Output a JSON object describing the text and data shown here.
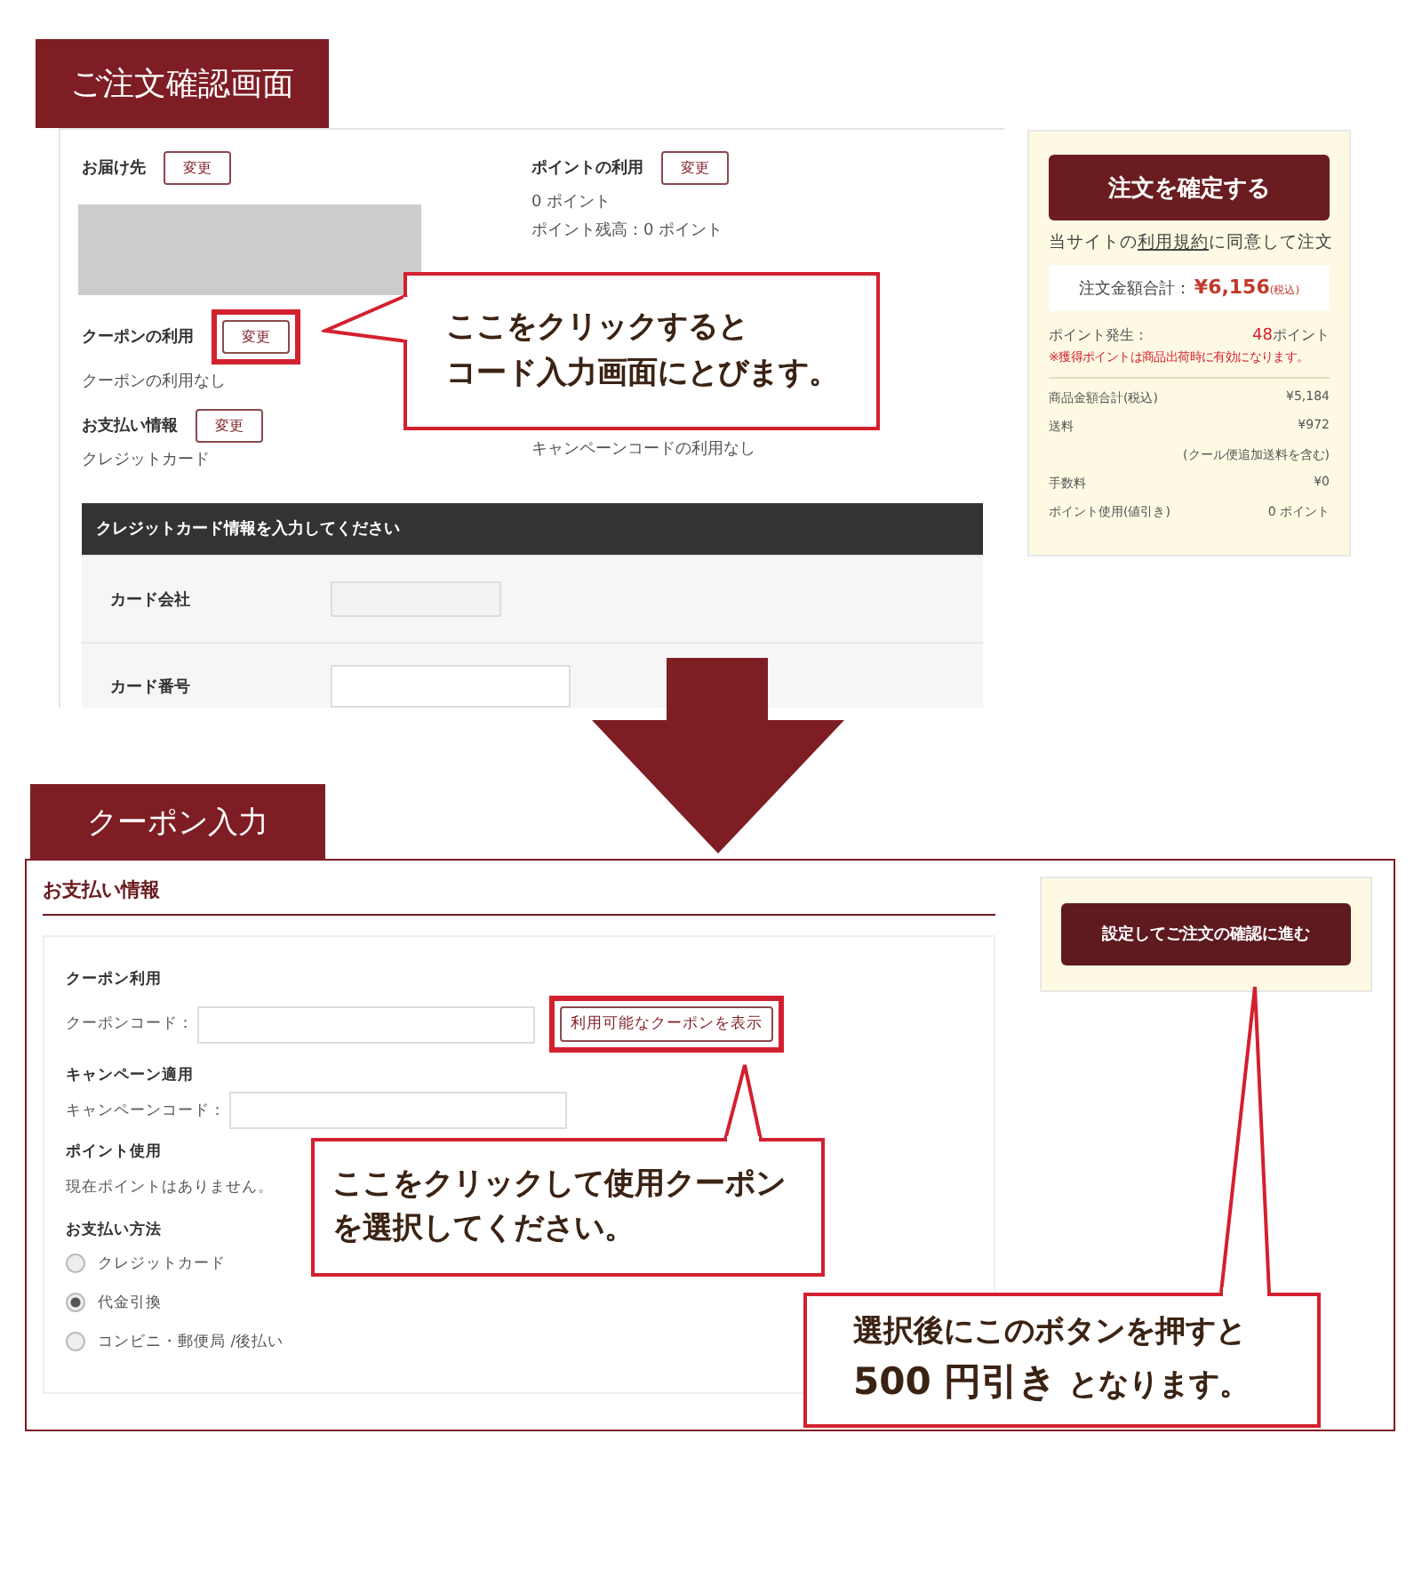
{
  "order_screen": {
    "title": "ご注文確認画面",
    "delivery": {
      "label": "お届け先",
      "button": "変更"
    },
    "points": {
      "label": "ポイントの利用",
      "button": "変更",
      "lines": [
        "0 ポイント",
        "ポイント残高：0 ポイント"
      ]
    },
    "coupon": {
      "label": "クーポンの利用",
      "button": "変更",
      "value": "クーポンの利用なし",
      "highlighted": true
    },
    "payment": {
      "label": "お支払い情報",
      "button": "変更",
      "value": "クレジットカード"
    },
    "campaign_value": "キャンペーンコードの利用なし",
    "card_form": {
      "heading": "クレジットカード情報を入力してください",
      "fields": [
        {
          "label": "カード会社"
        },
        {
          "label": "カード番号"
        }
      ]
    },
    "summary": {
      "confirm_button": "注文を確定する",
      "terms_before": "当サイトの",
      "terms_link": "利用規約",
      "terms_after": "に同意して注文",
      "total_label": "注文金額合計：",
      "total_value": "¥6,156",
      "total_tax": "(税込)",
      "points_label": "ポイント発生：",
      "points_value": "48",
      "points_unit": "ポイント",
      "points_note": "※獲得ポイントは商品出荷時に有効になります。",
      "rows": [
        {
          "label": "商品金額合計(税込)",
          "value": "¥5,184"
        },
        {
          "label": "送料",
          "value": "¥972"
        },
        {
          "label": "",
          "value": "(クール便追加送料を含む)"
        },
        {
          "label": "手数料",
          "value": "¥0"
        },
        {
          "label": "ポイント使用(値引き)",
          "value": "0 ポイント"
        }
      ]
    },
    "callout": [
      "ここをクリックすると",
      "コード入力画面にとびます。"
    ]
  },
  "coupon_screen": {
    "title": "クーポン入力",
    "heading": "お支払い情報",
    "coupon_group": "クーポン利用",
    "coupon_label": "クーポンコード：",
    "coupon_button": "利用可能なクーポンを表示",
    "coupon_button_highlighted": true,
    "campaign_group": "キャンペーン適用",
    "campaign_label": "キャンペーンコード：",
    "points_group": "ポイント使用",
    "points_text": "現在ポイントはありません。",
    "method_group": "お支払い方法",
    "methods": [
      {
        "label": "クレジットカード",
        "selected": false
      },
      {
        "label": "代金引換",
        "selected": true
      },
      {
        "label": "コンビニ・郵便局 /後払い",
        "selected": false
      }
    ],
    "proceed_button": "設定してご注文の確認に進む",
    "callout": [
      "ここをクリックして使用クーポン",
      "を選択してください。"
    ],
    "callout2": {
      "line1": "選択後にこのボタンを押すと",
      "emphasis": "500 円引き",
      "rest": " となります。"
    }
  }
}
